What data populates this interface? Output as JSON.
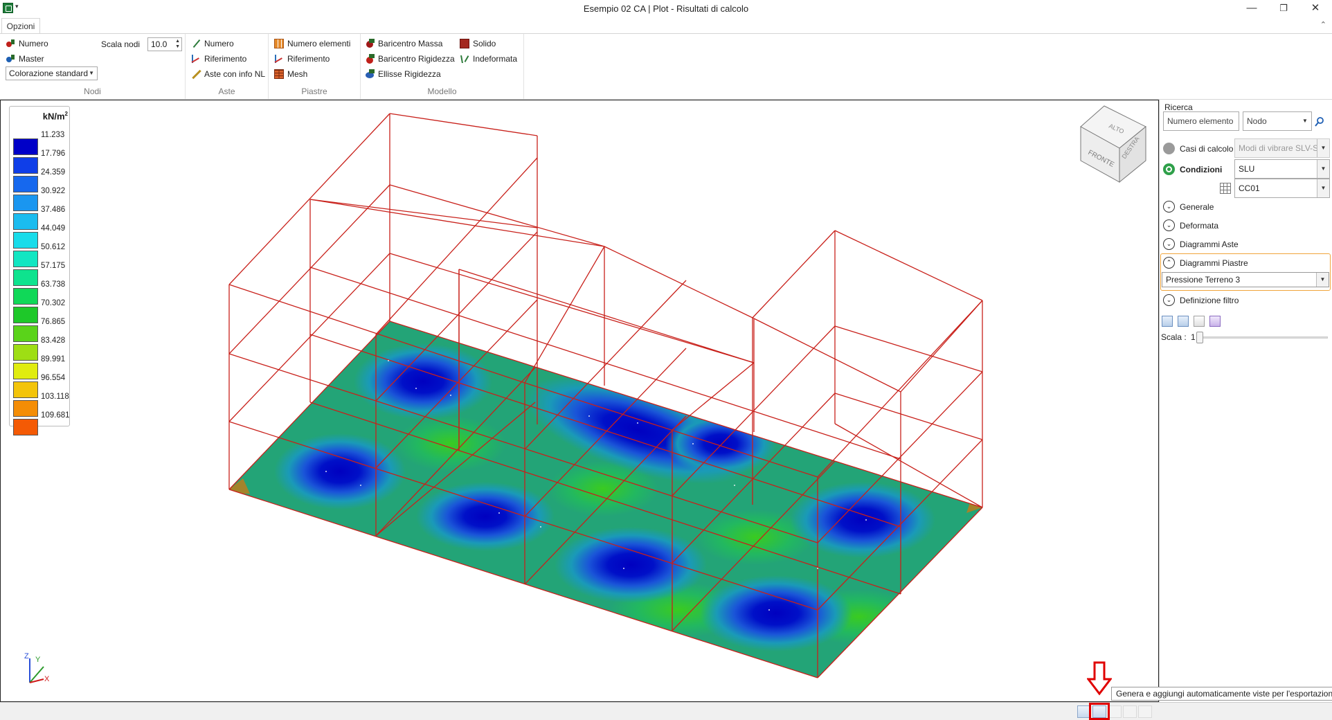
{
  "titlebar": {
    "title": "Esempio 02 CA | Plot - Risultati di calcolo",
    "minimize": "—",
    "restore": "❐",
    "close": "✕"
  },
  "ribbon": {
    "tab": "Opzioni",
    "collapse": "⌃",
    "nodi": {
      "label": "Nodi",
      "numero": "Numero",
      "master": "Master",
      "scala_nodi_label": "Scala nodi",
      "scala_nodi_value": "10.0",
      "colorazione": "Colorazione standard"
    },
    "aste": {
      "label": "Aste",
      "numero": "Numero",
      "riferimento": "Riferimento",
      "info_nl": "Aste con info NL"
    },
    "piastre": {
      "label": "Piastre",
      "numero_elementi": "Numero elementi",
      "riferimento": "Riferimento",
      "mesh": "Mesh"
    },
    "modello": {
      "label": "Modello",
      "baricentro_massa": "Baricentro Massa",
      "baricentro_rigidezza": "Baricentro Rigidezza",
      "ellisse_rigidezza": "Ellisse Rigidezza",
      "solido": "Solido",
      "indeformata": "Indeformata"
    }
  },
  "legend": {
    "unit": "kN/m",
    "unit_exp": "2",
    "values": [
      "11.233",
      "17.796",
      "24.359",
      "30.922",
      "37.486",
      "44.049",
      "50.612",
      "57.175",
      "63.738",
      "70.302",
      "76.865",
      "83.428",
      "89.991",
      "96.554",
      "103.118",
      "109.681"
    ],
    "colors": [
      "#0000c8",
      "#0f3ee8",
      "#1668ee",
      "#1a96f0",
      "#1bbcef",
      "#18dcea",
      "#12e6c2",
      "#0ee38e",
      "#10d858",
      "#1ec829",
      "#5ad31a",
      "#9ede14",
      "#e0ec0f",
      "#f3c40a",
      "#f48d06",
      "#f45a05"
    ]
  },
  "view_cube": {
    "top": "ALTO",
    "front": "FRONTE",
    "right": "DESTRA"
  },
  "axes": {
    "x": "X",
    "y": "Y",
    "z": "Z"
  },
  "right_panel": {
    "ricerca_label": "Ricerca",
    "numero_elemento_placeholder": "Numero elemento",
    "tipo": "Nodo",
    "casi_calcolo_label": "Casi di calcolo",
    "casi_calcolo_value": "Modi di vibrare SLV-S",
    "condizioni_label": "Condizioni",
    "condizioni_value": "SLU",
    "cc_value": "CC01",
    "sections": {
      "generale": "Generale",
      "deformata": "Deformata",
      "diagrammi_aste": "Diagrammi Aste",
      "diagrammi_piastre": "Diagrammi Piastre",
      "definizione_filtro": "Definizione filtro"
    },
    "diagram_select": "Pressione Terreno 3",
    "scala_label": "Scala :",
    "scala_value": "1"
  },
  "status": {
    "tooltip": "Genera e aggiungi automaticamente viste per l'esportazione"
  }
}
